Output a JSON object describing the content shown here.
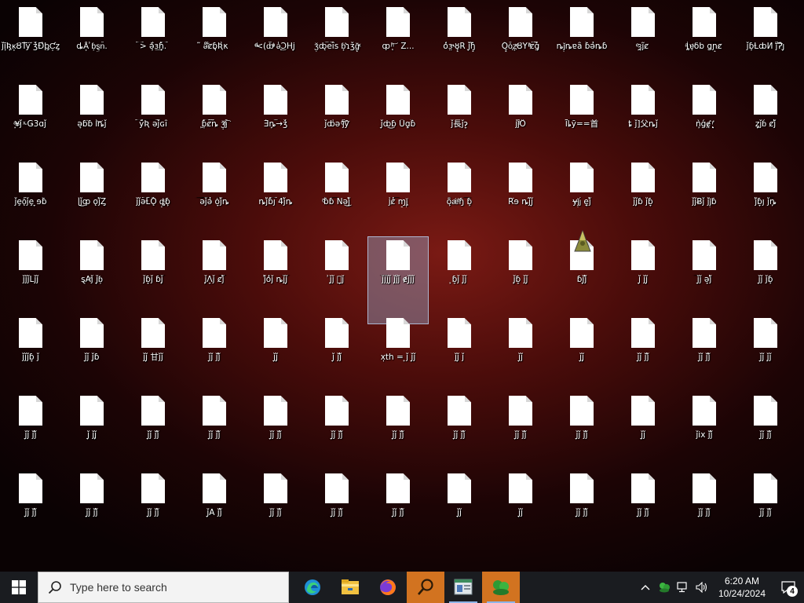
{
  "desktop": {
    "icons": [
      "ǰĩ̙Ʀ̘ĸ͙ȢŤÿ\n̆ǯ͑Ɖ̉ϸ̡Ƈ͙ȥ",
      "ȡÅ͙\n͗ɓ͕ȿ͖nͤ.",
      "͡>\nǝ̙͋ɜ͢ɦ͎͡.",
      "͂ \nǝͣ͋ȼɓ͉Ʀ͗κ",
      "ͤͩ<(ȸͣͦͥ\nǝͥ͜ͅϽHϳ̬",
      "ǯ͕ȸ̨͝e͝ȋs\nɓ̟͛ɿǯǧ̙ͯ",
      "ȹ ͎ͪ͝ͅ　͞Z...",
      "ȱ͗ɝ̤ȣ͎̟R\nǰ̬ɧ͎̿",
      "Ó̬̥ȱ͕ȥ̟ͯȢY\nͪͣ͗ȼ͠ǧ̙",
      "ȵǰ͕ȵɐȃ\nɓ̏ǝ̓ȵɓ",
      "ͤȝ͉ȷ͂ȼ　",
      "ͣȴͥɐ̨ͧ͘ȫb\nǥ͞ɲ͎͞ȼ",
      "ǰ͞ɓ̙ȽȸͶ\nǰͣ͞Ɂ̐ȷ̬",
      "̝ͣ¥ͧǰ\nͯ-Ǥ3ɑǰ",
      "ǝ͎ɓ͘ɓ\nƖͥ͝ȵǰ",
      "͡ȳ͞Ʀ͞\nǝ͝ǰɢȋ",
      "͖ɓ̩͡ȼ͠ȵ\nǯ͎ͣ͡ȷͨ",
      "Ǝ͗ȵ͎͝→ǯ͑",
      "ǰȸ̍ǝ\nͦ̑ȷͣ͞ȳ",
      "ǰ̞ȸ͜ɓ͒\nǙɑ̨͎ɓ̂",
      "ǰ長ǰɂ̞",
      "ȷ͗ǰ̆ͣȪ",
      "Ĩͯȴ͞ȳ==首",
      "ȶ\nǰ]父ȵǰ",
      "ǹ̙ǵɇ̨͐\n̨̛̙ͬͅ",
      "ȥ̙ǰɓ͐\nȼ͞ǰ̔",
      "ǰȩǭͩǰȩ\n̞ɘɓ̓",
      "ɭ͗ǰ͜ȹ\nǫ͞ǰ͗Ȥ",
      "ǰǰǝ͡Ƚ͡Ǫ\nȡ̞ͧɓ̙",
      "͞ǝ͞ǰǝ̔\nȱ̞ǰ͗ȵ",
      "ȵǰ͗ɓ͡ȷ\n4̑ǰ͗ȵ",
      "ͨ̆ɓ̒ɓ͞\nNǝ͜ǰ̔",
      "ȷ͗ȼ̔͞\nɱ̞ǰ̩͕",
      "ȭ̙ǽͪɧ\n͞ɓ̙",
      "R͘ɘ\nȵǰ̑ǰ̞",
      "ɏǰ͕ȷ͐\nȩ̞ǰ̓",
      "ǰǰ͞ͅɓ\nǰɓ̞",
      "ǰǰɃ͞ǰ\nǰǰ͕ɓ",
      "ǰ͗ɓ̞ȷ\nǰ͞ȵ̙",
      "ǰǰǰLǰǰ",
      "ȿA̛ǰ\nǰ̞ɓ͕",
      "ǰɓ̞ǰ\nɓ͞ǰ̙",
      "ǰ̙Ʌ̞ǰ\nȼ͞ǰ̔",
      "ǰ̓ȱ͗ǰ\nȵǰ͞ǰ̞",
      "͗ǰ̟ǰ\n生̞ǰ",
      "ǰ͞ȷ̍ǰǰ̞\nǰ̩ǰͨǰ\nɇǰ̞ǰǰ",
      "̙ɓ̞ǰ\nǰ̩ǰ",
      "ǰ̙ɓ̞\nǰǰ̞",
      "ɓǰ̞ǰ̔",
      "ǰ̞\nǰǰ̞",
      "͞ǰ̞ǰ\nǝ̞ǰ̔",
      "ǰ̞ǰ\nǰɓ̙",
      "ǰǰǰɓ̞\nǰ",
      "ǰ̞ǰ\nǰ̙ɓ",
      "ǰǰ̞\n甘ǰǰ",
      "ǰ̞ǰ\nǰǰ̔",
      "ǰ̞ǰ̙",
      "ǰ̞\nǰǰ̔",
      "xͅth = ͎ǰ\nǰ̞ǰ",
      "ǰǰ̞\nǰ",
      "ǰ̞ǰ",
      "ǰ̞ǰ̙",
      "ǰ̞ǰ\nǰǰ̔",
      "ǰ̞ǰ\nǰǰ̔",
      "ǰ̞ǰ\nǰ̙ǰ",
      "ǰ̞ǰ\nǰǰ̔",
      "ǰ̞\nǰǰ̙",
      "ǰ̞ǰ\nǰǰ̔",
      "ǰ̞ǰ\nǰǰ̔",
      "ǰ̞ǰ\nǰǰ̔",
      "ǰ̞ǰ\nǰǰ̔",
      "ǰ̞ǰ\nǰǰ̔",
      "ǰ̞ǰ\nǰǰ̔",
      "ǰ̞ǰ\nǰǰ̔",
      "ǰ̞ǰ\nǰǰ̔",
      "ǰ̞ǰ",
      "ǰix\nǰǰ̔",
      "ǰ̞ǰ\nǰǰ̔",
      "ǰ̞ǰ\nǰǰ̔",
      "ǰ̞ǰ\nǰǰ̔",
      "ǰ̞ǰ\nǰǰ̔",
      "ǰ̞Ã\nǰǰ̔",
      "ǰ̞ǰ\nǰǰ̔",
      "ǰ̞ǰ\nǰǰ̔",
      "ǰ̞ǰ\nǰǰ̔",
      "ǰ̞ǰ",
      "ǰ̞ǰ",
      "ǰ̞ǰ\nǰǰ̔",
      "ǰ̞ǰ\nǰǰ̔",
      "ǰ̞ǰ\nǰǰ̔",
      "ǰ̞ǰ\nǰǰ̔"
    ],
    "selected_index": 45
  },
  "taskbar": {
    "search_placeholder": "Type here to search",
    "apps": [
      "edge-icon",
      "file-explorer-icon",
      "firefox-icon",
      "search-app-icon",
      "window-app-icon",
      "game-app-icon"
    ],
    "clock": {
      "time": "6:20 AM",
      "date": "10/24/2024"
    },
    "notification_count": "4"
  },
  "colors": {
    "taskbar_bg": "#1a1c20",
    "search_bg": "#f3f3f3",
    "highlight_app": "#d27320",
    "selection": "#a0bee6"
  }
}
